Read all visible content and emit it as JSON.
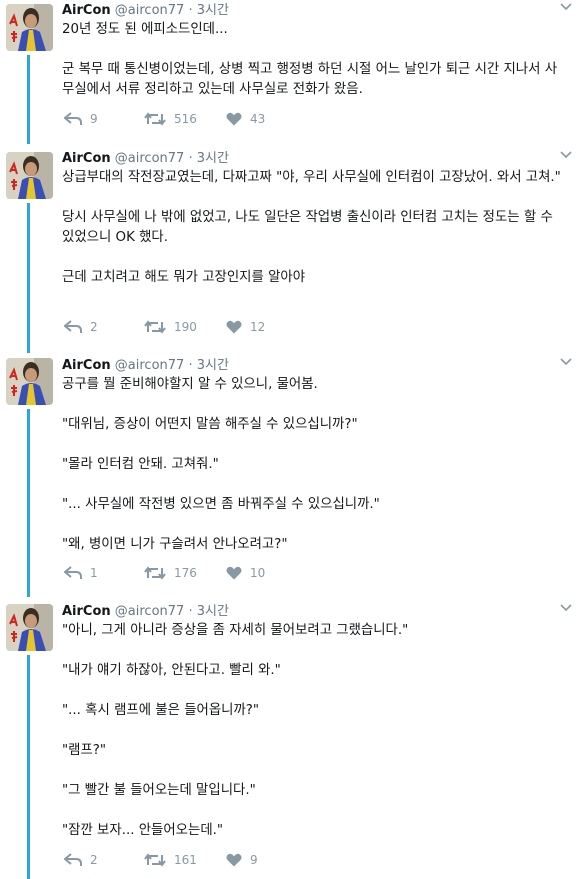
{
  "tweets": [
    {
      "name": "AirCon",
      "handle": "@aircon77",
      "dot": "·",
      "time": "3시간",
      "paragraphs": [
        "20년 정도 된 에피소드인데...",
        "군 복무 때 통신병이었는데, 상병 찍고 행정병 하던 시절 어느 날인가 퇴근 시간 지나서 사무실에서 서류 정리하고 있는데 사무실로 전화가 왔음."
      ],
      "replies": "9",
      "retweets": "516",
      "likes": "43"
    },
    {
      "name": "AirCon",
      "handle": "@aircon77",
      "dot": "·",
      "time": "3시간",
      "paragraphs": [
        "상급부대의 작전장교였는데, 다짜고짜 \"야, 우리 사무실에 인터컴이 고장났어. 와서 고쳐.\"",
        "당시 사무실에 나 밖에 없었고, 나도 일단은 작업병 출신이라 인터컴 고치는 정도는 할 수 있었으니 OK 했다.",
        "근데 고치려고 해도 뭐가 고장인지를 알아야"
      ],
      "replies": "2",
      "retweets": "190",
      "likes": "12"
    },
    {
      "name": "AirCon",
      "handle": "@aircon77",
      "dot": "·",
      "time": "3시간",
      "paragraphs": [
        "공구를 뭘 준비해야할지 알 수 있으니, 물어봄.",
        "\"대위님, 증상이 어떤지 말씀 해주실 수 있으십니까?\"",
        "\"몰라 인터컴 안돼. 고쳐줘.\"",
        "\"... 사무실에 작전병 있으면 좀 바꿔주실 수 있으십니까.\"",
        "\"왜, 병이면 니가 구슬려서 안나오려고?\""
      ],
      "replies": "1",
      "retweets": "176",
      "likes": "10"
    },
    {
      "name": "AirCon",
      "handle": "@aircon77",
      "dot": "·",
      "time": "3시간",
      "paragraphs": [
        "\"아니, 그게 아니라 증상을 좀 자세히 물어보려고 그랬습니다.\"",
        "\"내가 얘기 하잖아, 안된다고. 빨리 와.\"",
        "\"... 혹시 램프에 불은 들어옵니까?\"",
        "\"램프?\"",
        "\"그 빨간 불 들어오는데 말입니다.\"",
        "\"잠깐 보자... 안들어오는데.\""
      ],
      "replies": "2",
      "retweets": "161",
      "likes": "9"
    }
  ]
}
